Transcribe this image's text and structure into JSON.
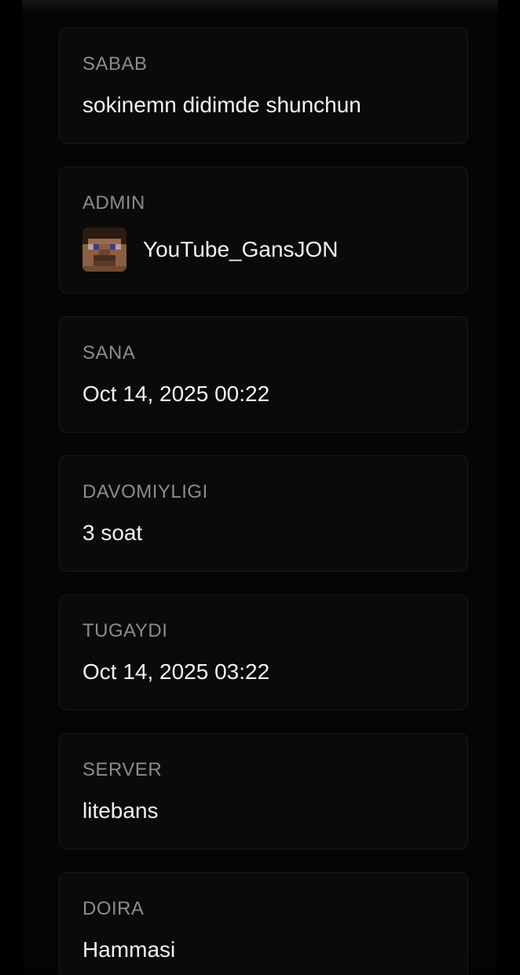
{
  "details": {
    "reason": {
      "label": "SABAB",
      "value": "sokinemn didimde shunchun"
    },
    "admin": {
      "label": "ADMIN",
      "name": "YouTube_GansJON",
      "avatar_icon": "minecraft-steve-head-icon"
    },
    "date": {
      "label": "SANA",
      "value": "Oct 14, 2025 00:22"
    },
    "duration": {
      "label": "DAVOMIYLIGI",
      "value": "3 soat"
    },
    "expires": {
      "label": "TUGAYDI",
      "value": "Oct 14, 2025 03:22"
    },
    "server": {
      "label": "SERVER",
      "value": "litebans"
    },
    "scope": {
      "label": "DOIRA",
      "value": "Hammasi"
    }
  },
  "colors": {
    "background": "#000000",
    "card_background": "#0a0a0a",
    "card_border": "#181818",
    "label": "#8c8c8c",
    "value": "#f2f2f2"
  }
}
